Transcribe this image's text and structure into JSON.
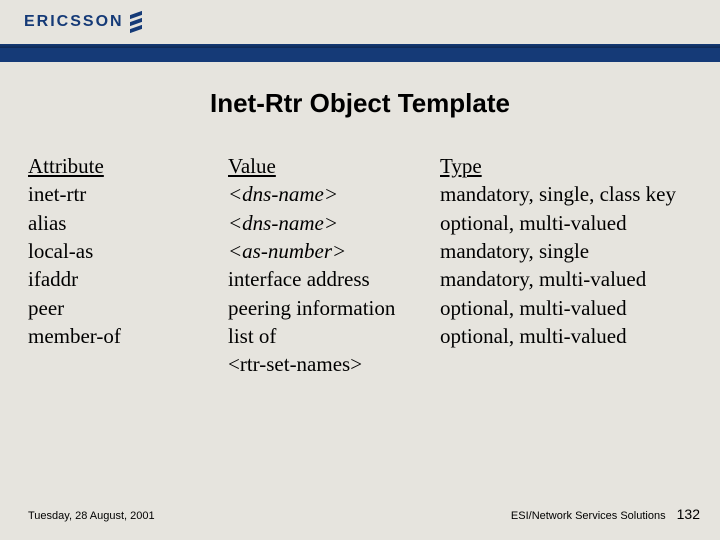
{
  "brand": "ERICSSON",
  "title": "Inet-Rtr Object Template",
  "columns": {
    "attribute_header": "Attribute",
    "value_header": "Value",
    "type_header": "Type"
  },
  "rows": [
    {
      "attribute": "inet-rtr",
      "value": "<dns-name>",
      "value_italic": true,
      "type": "mandatory, single, class key"
    },
    {
      "attribute": "alias",
      "value": "<dns-name>",
      "value_italic": true,
      "type": "optional, multi-valued"
    },
    {
      "attribute": "local-as",
      "value": "<as-number>",
      "value_italic": true,
      "type": "mandatory, single"
    },
    {
      "attribute": "ifaddr",
      "value": "interface address",
      "value_italic": false,
      "type": "mandatory, multi-valued"
    },
    {
      "attribute": "peer",
      "value": "peering information",
      "value_italic": false,
      "type": "optional, multi-valued"
    },
    {
      "attribute": "member-of",
      "value": "list of\n<rtr-set-names>",
      "value_italic": false,
      "type": "optional, multi-valued"
    }
  ],
  "footer": {
    "date": "Tuesday, 28 August, 2001",
    "right": "ESI/Network Services Solutions",
    "page": "132"
  }
}
